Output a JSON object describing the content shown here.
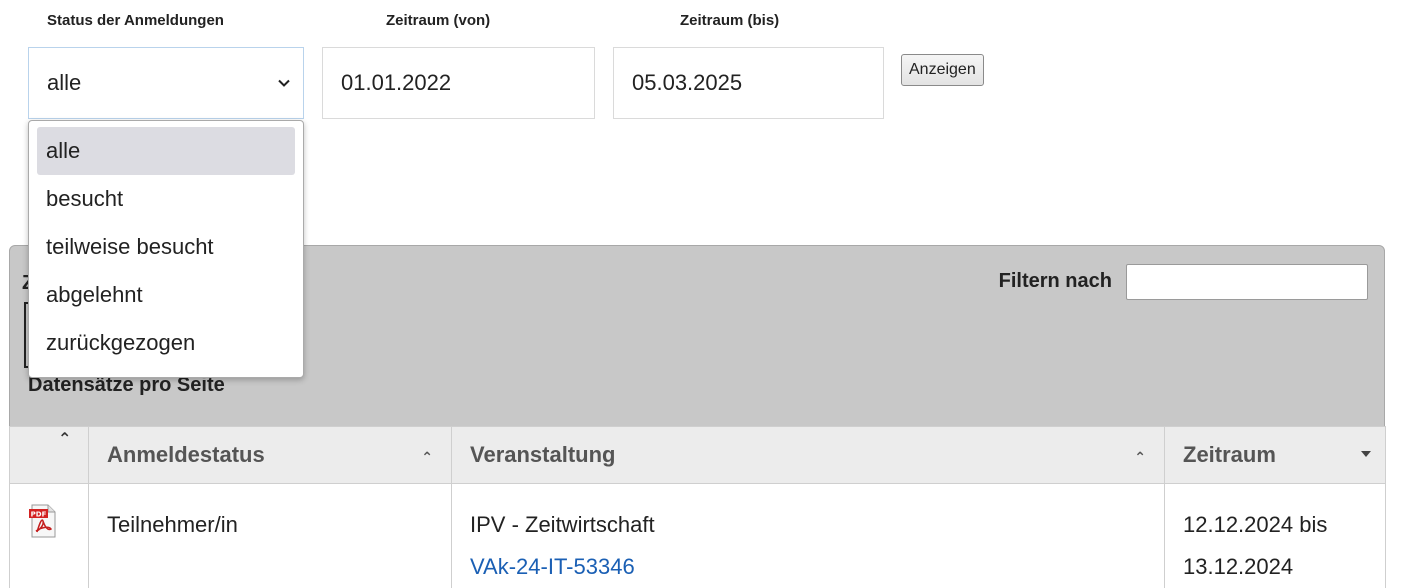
{
  "filters": {
    "status_label": "Status der Anmeldungen",
    "from_label": "Zeitraum (von)",
    "to_label": "Zeitraum (bis)",
    "status_value": "alle",
    "from_value": "01.01.2022",
    "to_value": "05.03.2025",
    "show_button": "Anzeigen"
  },
  "status_options": [
    "alle",
    "besucht",
    "teilweise besucht",
    "abgelehnt",
    "zurückgezogen"
  ],
  "panel": {
    "partial_letter": "Z",
    "per_page_label": "Datensätze pro Seite",
    "filter_label": "Filtern nach",
    "filter_value": ""
  },
  "table": {
    "columns": [
      "Anmeldestatus",
      "Veranstaltung",
      "Zeitraum"
    ],
    "rows": [
      {
        "icon": "pdf-icon",
        "status": "Teilnehmer/in",
        "event_title": "IPV - Zeitwirtschaft",
        "event_code": "VAk-24-IT-53346",
        "period_start": "12.12.2024 bis",
        "period_end": "13.12.2024"
      }
    ]
  },
  "colors": {
    "link": "#1a5fb4",
    "panel_bg": "#c8c8c8",
    "header_bg": "#ececec",
    "dropdown_selected": "#dcdce2"
  }
}
